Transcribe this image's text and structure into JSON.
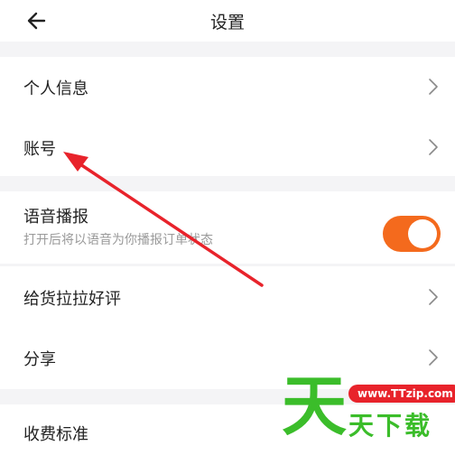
{
  "header": {
    "title": "设置",
    "back_icon": "arrow-left-icon"
  },
  "settings": {
    "personal_info": "个人信息",
    "account": "账号",
    "voice_broadcast": {
      "label": "语音播报",
      "description": "打开后将以语音为你播报订单状态",
      "enabled": true,
      "toggle_color": "#f46a1d"
    },
    "rate_app": "给货拉拉好评",
    "share": "分享",
    "fee_standard": "收费标准"
  },
  "watermark": {
    "big_char": "天",
    "url": "www.TTzip.com",
    "text": "天下载"
  },
  "colors": {
    "background": "#f4f4f6",
    "accent": "#f46a1d",
    "annotation_arrow": "#e8232b",
    "watermark_green": "#3bbd2a"
  }
}
